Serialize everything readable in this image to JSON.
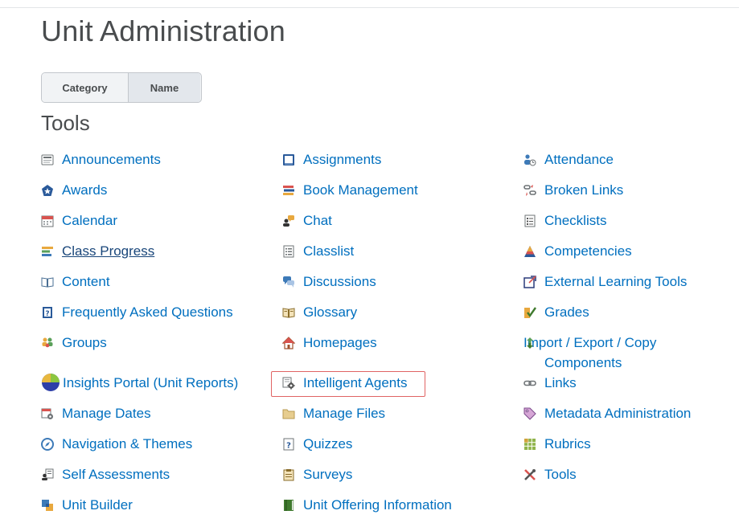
{
  "page": {
    "title": "Unit Administration"
  },
  "sort": {
    "category_label": "Category",
    "name_label": "Name"
  },
  "section": {
    "title": "Tools"
  },
  "tools": {
    "announcements": {
      "label": "Announcements",
      "icon": "announcements-icon"
    },
    "assignments": {
      "label": "Assignments",
      "icon": "assignments-icon"
    },
    "attendance": {
      "label": "Attendance",
      "icon": "attendance-icon"
    },
    "awards": {
      "label": "Awards",
      "icon": "awards-icon"
    },
    "book_management": {
      "label": "Book Management",
      "icon": "book-management-icon"
    },
    "broken_links": {
      "label": "Broken Links",
      "icon": "broken-links-icon"
    },
    "calendar": {
      "label": "Calendar",
      "icon": "calendar-icon"
    },
    "chat": {
      "label": "Chat",
      "icon": "chat-icon"
    },
    "checklists": {
      "label": "Checklists",
      "icon": "checklists-icon"
    },
    "class_progress": {
      "label": "Class Progress",
      "icon": "class-progress-icon"
    },
    "classlist": {
      "label": "Classlist",
      "icon": "classlist-icon"
    },
    "competencies": {
      "label": "Competencies",
      "icon": "competencies-icon"
    },
    "content": {
      "label": "Content",
      "icon": "content-icon"
    },
    "discussions": {
      "label": "Discussions",
      "icon": "discussions-icon"
    },
    "external_learning_tools": {
      "label": "External Learning Tools",
      "icon": "external-learning-tools-icon"
    },
    "faq": {
      "label": "Frequently Asked Questions",
      "icon": "faq-icon"
    },
    "glossary": {
      "label": "Glossary",
      "icon": "glossary-icon"
    },
    "grades": {
      "label": "Grades",
      "icon": "grades-icon"
    },
    "groups": {
      "label": "Groups",
      "icon": "groups-icon"
    },
    "homepages": {
      "label": "Homepages",
      "icon": "homepages-icon"
    },
    "import_export": {
      "label": "Import / Export / Copy Components",
      "icon": "import-export-icon"
    },
    "insights": {
      "label": "Insights Portal (Unit Reports)",
      "icon": "insights-pie-icon"
    },
    "intelligent_agents": {
      "label": "Intelligent Agents",
      "icon": "intelligent-agents-icon"
    },
    "links": {
      "label": "Links",
      "icon": "links-icon"
    },
    "manage_dates": {
      "label": "Manage Dates",
      "icon": "manage-dates-icon"
    },
    "manage_files": {
      "label": "Manage Files",
      "icon": "folder-icon"
    },
    "metadata": {
      "label": "Metadata Administration",
      "icon": "tag-icon"
    },
    "navigation": {
      "label": "Navigation & Themes",
      "icon": "compass-icon"
    },
    "quizzes": {
      "label": "Quizzes",
      "icon": "quizzes-icon"
    },
    "rubrics": {
      "label": "Rubrics",
      "icon": "rubrics-icon"
    },
    "self_assessments": {
      "label": "Self Assessments",
      "icon": "self-assessments-icon"
    },
    "surveys": {
      "label": "Surveys",
      "icon": "surveys-icon"
    },
    "tools_tool": {
      "label": "Tools",
      "icon": "tools-icon"
    },
    "unit_builder": {
      "label": "Unit Builder",
      "icon": "unit-builder-icon"
    },
    "unit_offering": {
      "label": "Unit Offering Information",
      "icon": "unit-offering-icon"
    }
  },
  "colors": {
    "link": "#006fbf",
    "text": "#494c4e",
    "highlight": "#e06464"
  }
}
